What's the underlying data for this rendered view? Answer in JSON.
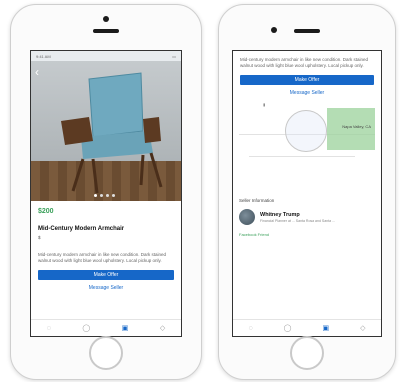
{
  "listing": {
    "price": "$200",
    "title": "Mid-Century Modern Armchair",
    "category": "$",
    "description": "Mid-century modern armchair in like new condition. Dark stained walnut wood with light blue wool upholstery. Local pickup only.",
    "status_time": "9:41 AM"
  },
  "actions": {
    "make_offer": "Make Offer",
    "message_seller": "Message Seller"
  },
  "map": {
    "pin_label": "Napa Valley, CA"
  },
  "seller": {
    "section_label": "Seller Information",
    "name": "Whitney Trump",
    "meta": "Financial Planner at ... Santa Rosa and Santa ...",
    "verified": "Facebook Friend"
  },
  "tabbar": {
    "icons": [
      "home-icon",
      "search-icon",
      "marketplace-icon",
      "notifications-icon"
    ]
  },
  "colors": {
    "accent": "#1667c8",
    "price": "#3aa05a"
  }
}
